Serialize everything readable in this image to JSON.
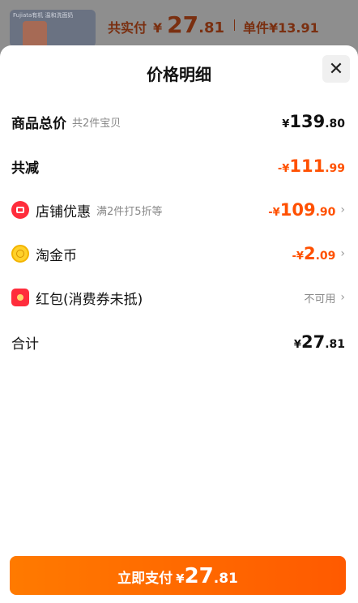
{
  "background": {
    "thumb_caption": "Fujiata有机 温和洗面奶",
    "total_label": "共实付",
    "total_yen": "¥",
    "total_int": "27",
    "total_dec": ".81",
    "unit_label": "单件",
    "unit_price": "¥13.91"
  },
  "sheet": {
    "title": "价格明细",
    "close_symbol": "✕"
  },
  "rows": {
    "goods_total": {
      "label": "商品总价",
      "sub": "共2件宝贝",
      "yen": "¥",
      "int": "139",
      "dec": ".80"
    },
    "total_reduce": {
      "label": "共减",
      "yen": "-¥",
      "int": "111",
      "dec": ".99"
    },
    "shop_discount": {
      "label": "店铺优惠",
      "sub": "满2件打5折等",
      "yen": "-¥",
      "int": "109",
      "dec": ".90",
      "icon": "shop-icon"
    },
    "taojinbi": {
      "label": "淘金币",
      "yen": "-¥",
      "int": "2",
      "dec": ".09",
      "icon": "coin-icon"
    },
    "red_packet": {
      "label": "红包(消费券未抵)",
      "status": "不可用",
      "icon": "red-packet-icon"
    },
    "sum": {
      "label": "合计",
      "yen": "¥",
      "int": "27",
      "dec": ".81"
    }
  },
  "chevron": "›",
  "pay_button": {
    "label": "立即支付",
    "yen": "¥",
    "int": "27",
    "dec": ".81"
  },
  "colors": {
    "accent": "#ff5000",
    "button": "#ff6a00"
  }
}
